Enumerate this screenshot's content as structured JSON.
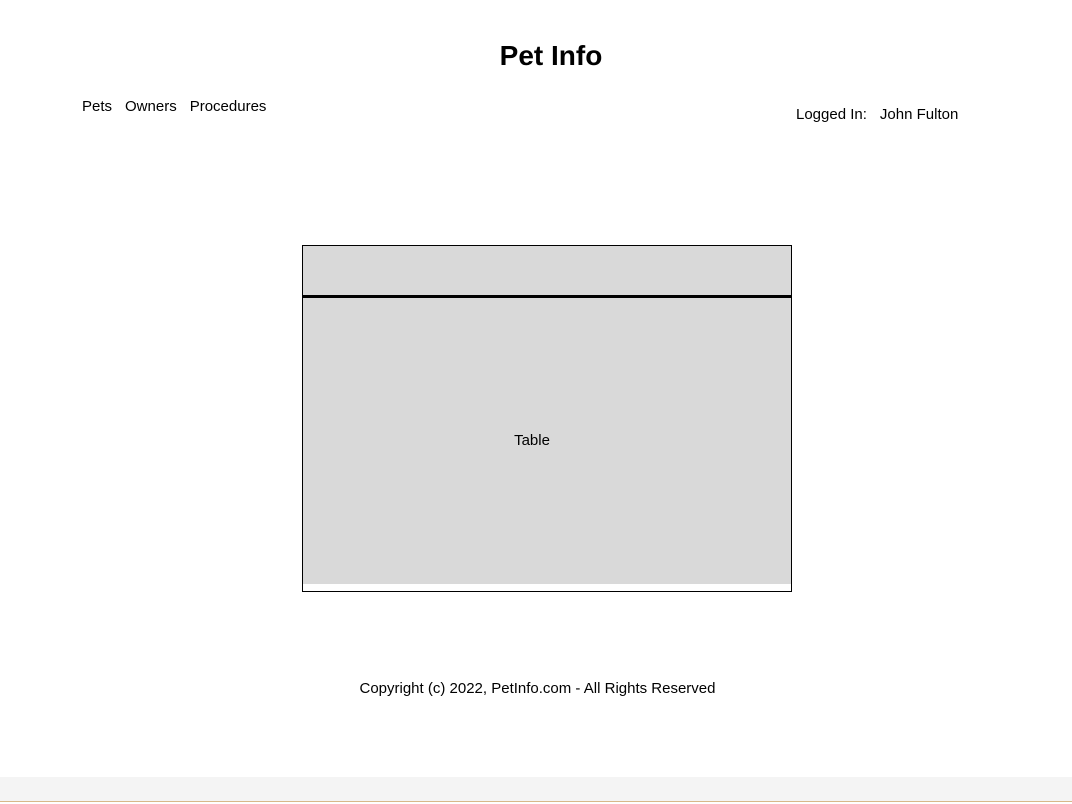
{
  "header": {
    "title": "Pet Info"
  },
  "nav": {
    "items": [
      {
        "label": "Pets"
      },
      {
        "label": "Owners"
      },
      {
        "label": "Procedures"
      }
    ]
  },
  "user": {
    "logged_in_label": "Logged In:",
    "name": "John Fulton"
  },
  "main": {
    "table_placeholder": "Table"
  },
  "footer": {
    "copyright": "Copyright (c) 2022, PetInfo.com - All Rights Reserved"
  },
  "colors": {
    "table_fill": "#d9d9d9",
    "bottom_band": "#f4f4f4",
    "bottom_band_border": "#d8b88a"
  }
}
